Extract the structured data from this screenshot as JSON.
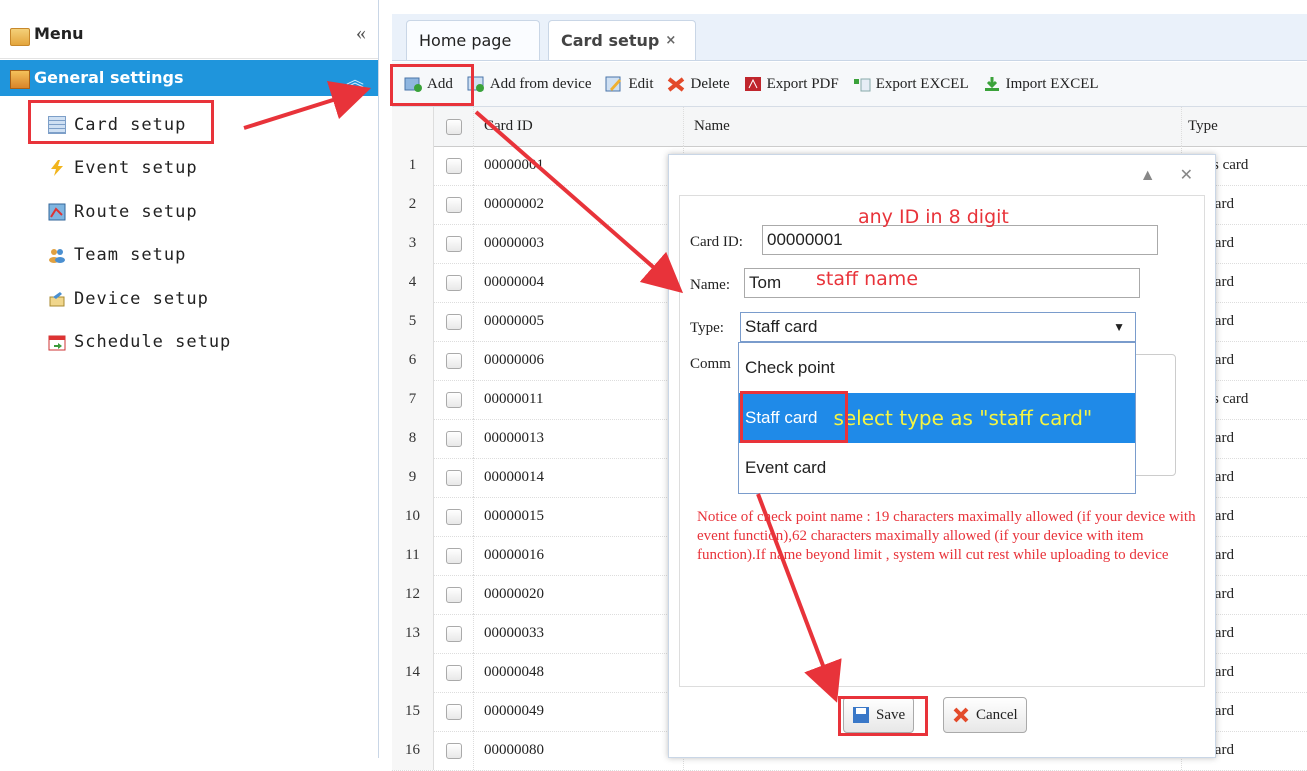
{
  "menu": {
    "title": "Menu",
    "collapse_glyph": "«",
    "group_title": "General settings",
    "group_chevron": "︽",
    "items": [
      {
        "label": "Card setup",
        "icon": "card-icon"
      },
      {
        "label": "Event setup",
        "icon": "lightning-icon"
      },
      {
        "label": "Route setup",
        "icon": "map-icon"
      },
      {
        "label": "Team setup",
        "icon": "team-icon"
      },
      {
        "label": "Device setup",
        "icon": "device-icon"
      },
      {
        "label": "Schedule setup",
        "icon": "calendar-icon"
      }
    ]
  },
  "tabs": [
    {
      "label": "Home page"
    },
    {
      "label": "Card setup",
      "close": "×"
    }
  ],
  "toolbar": {
    "add": "Add",
    "add_from_device": "Add from device",
    "edit": "Edit",
    "delete": "Delete",
    "export_pdf": "Export PDF",
    "export_excel": "Export EXCEL",
    "import_excel": "Import EXCEL"
  },
  "grid": {
    "columns": [
      "Card ID",
      "Name",
      "Type"
    ],
    "rows": [
      {
        "n": "1",
        "id": "00000001",
        "type": "dress card"
      },
      {
        "n": "2",
        "id": "00000002",
        "type": "aff card"
      },
      {
        "n": "3",
        "id": "00000003",
        "type": "aff card"
      },
      {
        "n": "4",
        "id": "00000004",
        "type": "aff card"
      },
      {
        "n": "5",
        "id": "00000005",
        "type": "aff card"
      },
      {
        "n": "6",
        "id": "00000006",
        "type": "aff card"
      },
      {
        "n": "7",
        "id": "00000011",
        "type": "dress card"
      },
      {
        "n": "8",
        "id": "00000013",
        "type": "aff card"
      },
      {
        "n": "9",
        "id": "00000014",
        "type": "aff card"
      },
      {
        "n": "10",
        "id": "00000015",
        "type": "aff card"
      },
      {
        "n": "11",
        "id": "00000016",
        "type": "aff card"
      },
      {
        "n": "12",
        "id": "00000020",
        "type": "aff card"
      },
      {
        "n": "13",
        "id": "00000033",
        "type": "aff card"
      },
      {
        "n": "14",
        "id": "00000048",
        "type": "aff card"
      },
      {
        "n": "15",
        "id": "00000049",
        "type": "aff card"
      },
      {
        "n": "16",
        "id": "00000080",
        "type": "aff card"
      }
    ]
  },
  "dialog": {
    "controls": "▲ ✕",
    "card_id_label": "Card ID:",
    "card_id_value": "00000001",
    "name_label": "Name:",
    "name_value": "Tom",
    "type_label": "Type:",
    "type_value": "Staff card",
    "type_arrow": "▼",
    "comment_label": "Comm",
    "options": [
      "Check point",
      "Staff card",
      "Event card"
    ],
    "notice": "Notice of check point name : 19 characters maximally allowed (if your device with event function),62 characters maximally allowed (if your device with item function).If name beyond limit , system will cut rest while uploading to device",
    "save": "Save",
    "cancel": "Cancel"
  },
  "annotations": {
    "id_hint": "any ID in 8 digit",
    "name_hint": "staff name",
    "type_hint": "select type as \"staff card\""
  },
  "colors": {
    "accent": "#1f95dc",
    "annotation": "#e8333a",
    "highlight_text": "#f5f542"
  }
}
